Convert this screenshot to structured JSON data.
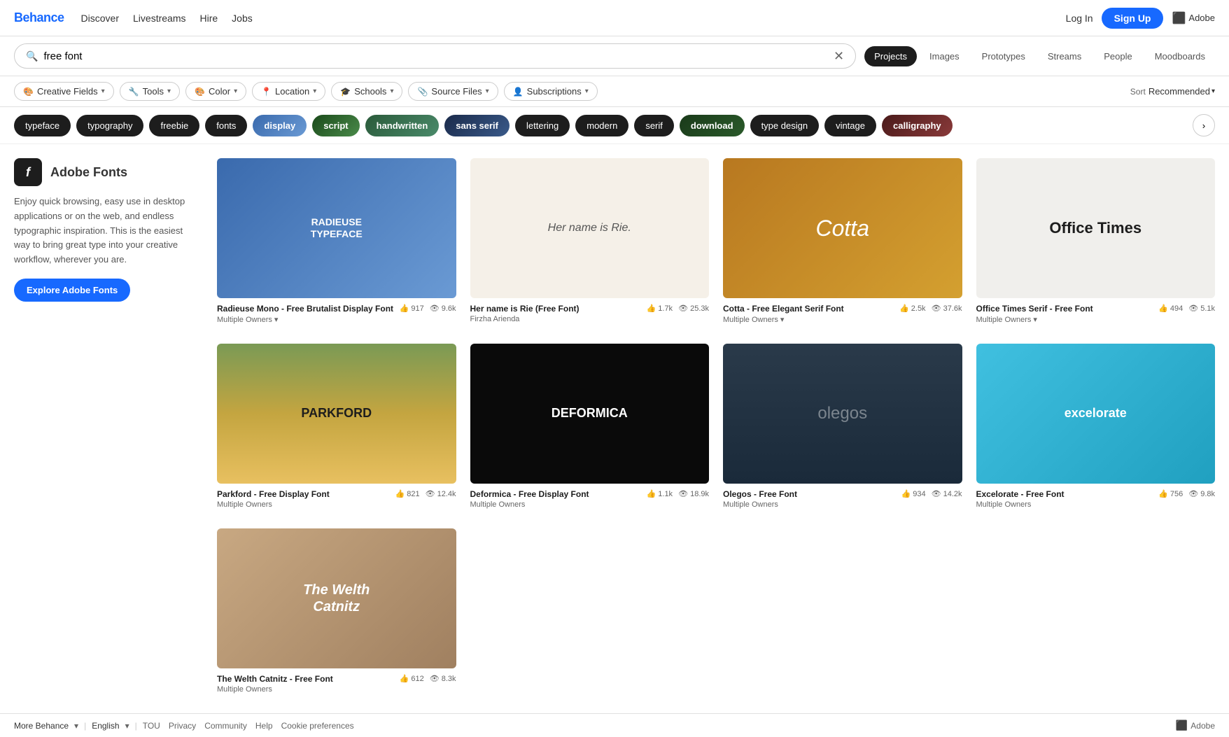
{
  "header": {
    "logo": "Behance",
    "nav": [
      "Discover",
      "Livestreams",
      "Hire",
      "Jobs"
    ],
    "login": "Log In",
    "signup": "Sign Up",
    "adobe": "Adobe"
  },
  "search": {
    "query": "free font",
    "placeholder": "free font",
    "tabs": [
      "Projects",
      "Images",
      "Prototypes",
      "Streams",
      "People",
      "Moodboards"
    ],
    "active_tab": "Projects"
  },
  "filters": [
    {
      "label": "Creative Fields",
      "icon": "creative-icon"
    },
    {
      "label": "Tools",
      "icon": "tools-icon"
    },
    {
      "label": "Color",
      "icon": "color-icon"
    },
    {
      "label": "Location",
      "icon": "location-icon"
    },
    {
      "label": "Schools",
      "icon": "schools-icon"
    },
    {
      "label": "Source Files",
      "icon": "source-files-icon"
    },
    {
      "label": "Subscriptions",
      "icon": "subscriptions-icon"
    }
  ],
  "sort": {
    "label": "Sort",
    "value": "Recommended"
  },
  "tags": [
    {
      "label": "typeface",
      "style": "dark"
    },
    {
      "label": "typography",
      "style": "dark"
    },
    {
      "label": "freebie",
      "style": "dark"
    },
    {
      "label": "fonts",
      "style": "dark"
    },
    {
      "label": "display",
      "style": "image",
      "bg": "tag-display"
    },
    {
      "label": "script",
      "style": "image",
      "bg": "tag-script"
    },
    {
      "label": "handwritten",
      "style": "image",
      "bg": "tag-handwritten"
    },
    {
      "label": "sans serif",
      "style": "image",
      "bg": "tag-sans-serif"
    },
    {
      "label": "lettering",
      "style": "dark"
    },
    {
      "label": "modern",
      "style": "dark"
    },
    {
      "label": "serif",
      "style": "dark"
    },
    {
      "label": "download",
      "style": "image",
      "bg": "tag-download"
    },
    {
      "label": "type design",
      "style": "dark"
    },
    {
      "label": "vintage",
      "style": "dark"
    },
    {
      "label": "calligraphy",
      "style": "image",
      "bg": "tag-calligraphy"
    }
  ],
  "sidebar": {
    "adobe_fonts": {
      "icon_letter": "f",
      "title": "Adobe Fonts",
      "description": "Enjoy quick browsing, easy use in desktop applications or on the web, and endless typographic inspiration. This is the easiest way to bring great type into your creative workflow, wherever you are.",
      "cta": "Explore Adobe Fonts"
    }
  },
  "cards": [
    {
      "title": "Radieuse Mono - Free Brutalist Display Font",
      "author": "Multiple Owners",
      "likes": "917",
      "views": "9.6k",
      "thumb_class": "thumb-radieuse",
      "thumb_text": "RADIEUSE TYPEFACE",
      "author_arrow": true
    },
    {
      "title": "Her name is Rie (Free Font)",
      "author": "Firzha Arienda",
      "likes": "1.7k",
      "views": "25.3k",
      "thumb_class": "thumb-rie",
      "thumb_text": "Her name is Rie."
    },
    {
      "title": "Cotta - Free Elegant Serif Font",
      "author": "Multiple Owners",
      "likes": "2.5k",
      "views": "37.6k",
      "thumb_class": "thumb-cotta",
      "thumb_text": "Cotta",
      "author_arrow": true
    },
    {
      "title": "Office Times Serif - Free Font",
      "author": "Multiple Owners",
      "likes": "494",
      "views": "5.1k",
      "thumb_class": "thumb-office",
      "thumb_text": "Office Times",
      "author_arrow": true
    },
    {
      "title": "Parkford - Free Display Font",
      "author": "Multiple Owners",
      "likes": "821",
      "views": "12.4k",
      "thumb_class": "thumb-parkford",
      "thumb_text": "PARKFORD"
    },
    {
      "title": "Deformica - Free Display Font",
      "author": "Multiple Owners",
      "likes": "1.1k",
      "views": "18.9k",
      "thumb_class": "thumb-deformica",
      "thumb_text": "DEFORMICA"
    },
    {
      "title": "Olegos - Free Font",
      "author": "Multiple Owners",
      "likes": "934",
      "views": "14.2k",
      "thumb_class": "thumb-olegos",
      "thumb_text": "olegos"
    },
    {
      "title": "Excelorate - Free Font",
      "author": "Multiple Owners",
      "likes": "756",
      "views": "9.8k",
      "thumb_class": "thumb-excelorate",
      "thumb_text": "excelorate"
    },
    {
      "title": "The Welth Catnitz - Free Font",
      "author": "Multiple Owners",
      "likes": "612",
      "views": "8.3k",
      "thumb_class": "thumb-welth",
      "thumb_text": "The Welth Catnitz"
    }
  ],
  "footer": {
    "more_behance": "More Behance",
    "language": "English",
    "links": [
      "TOU",
      "Privacy",
      "Community",
      "Help",
      "Cookie preferences"
    ],
    "adobe": "Adobe"
  }
}
